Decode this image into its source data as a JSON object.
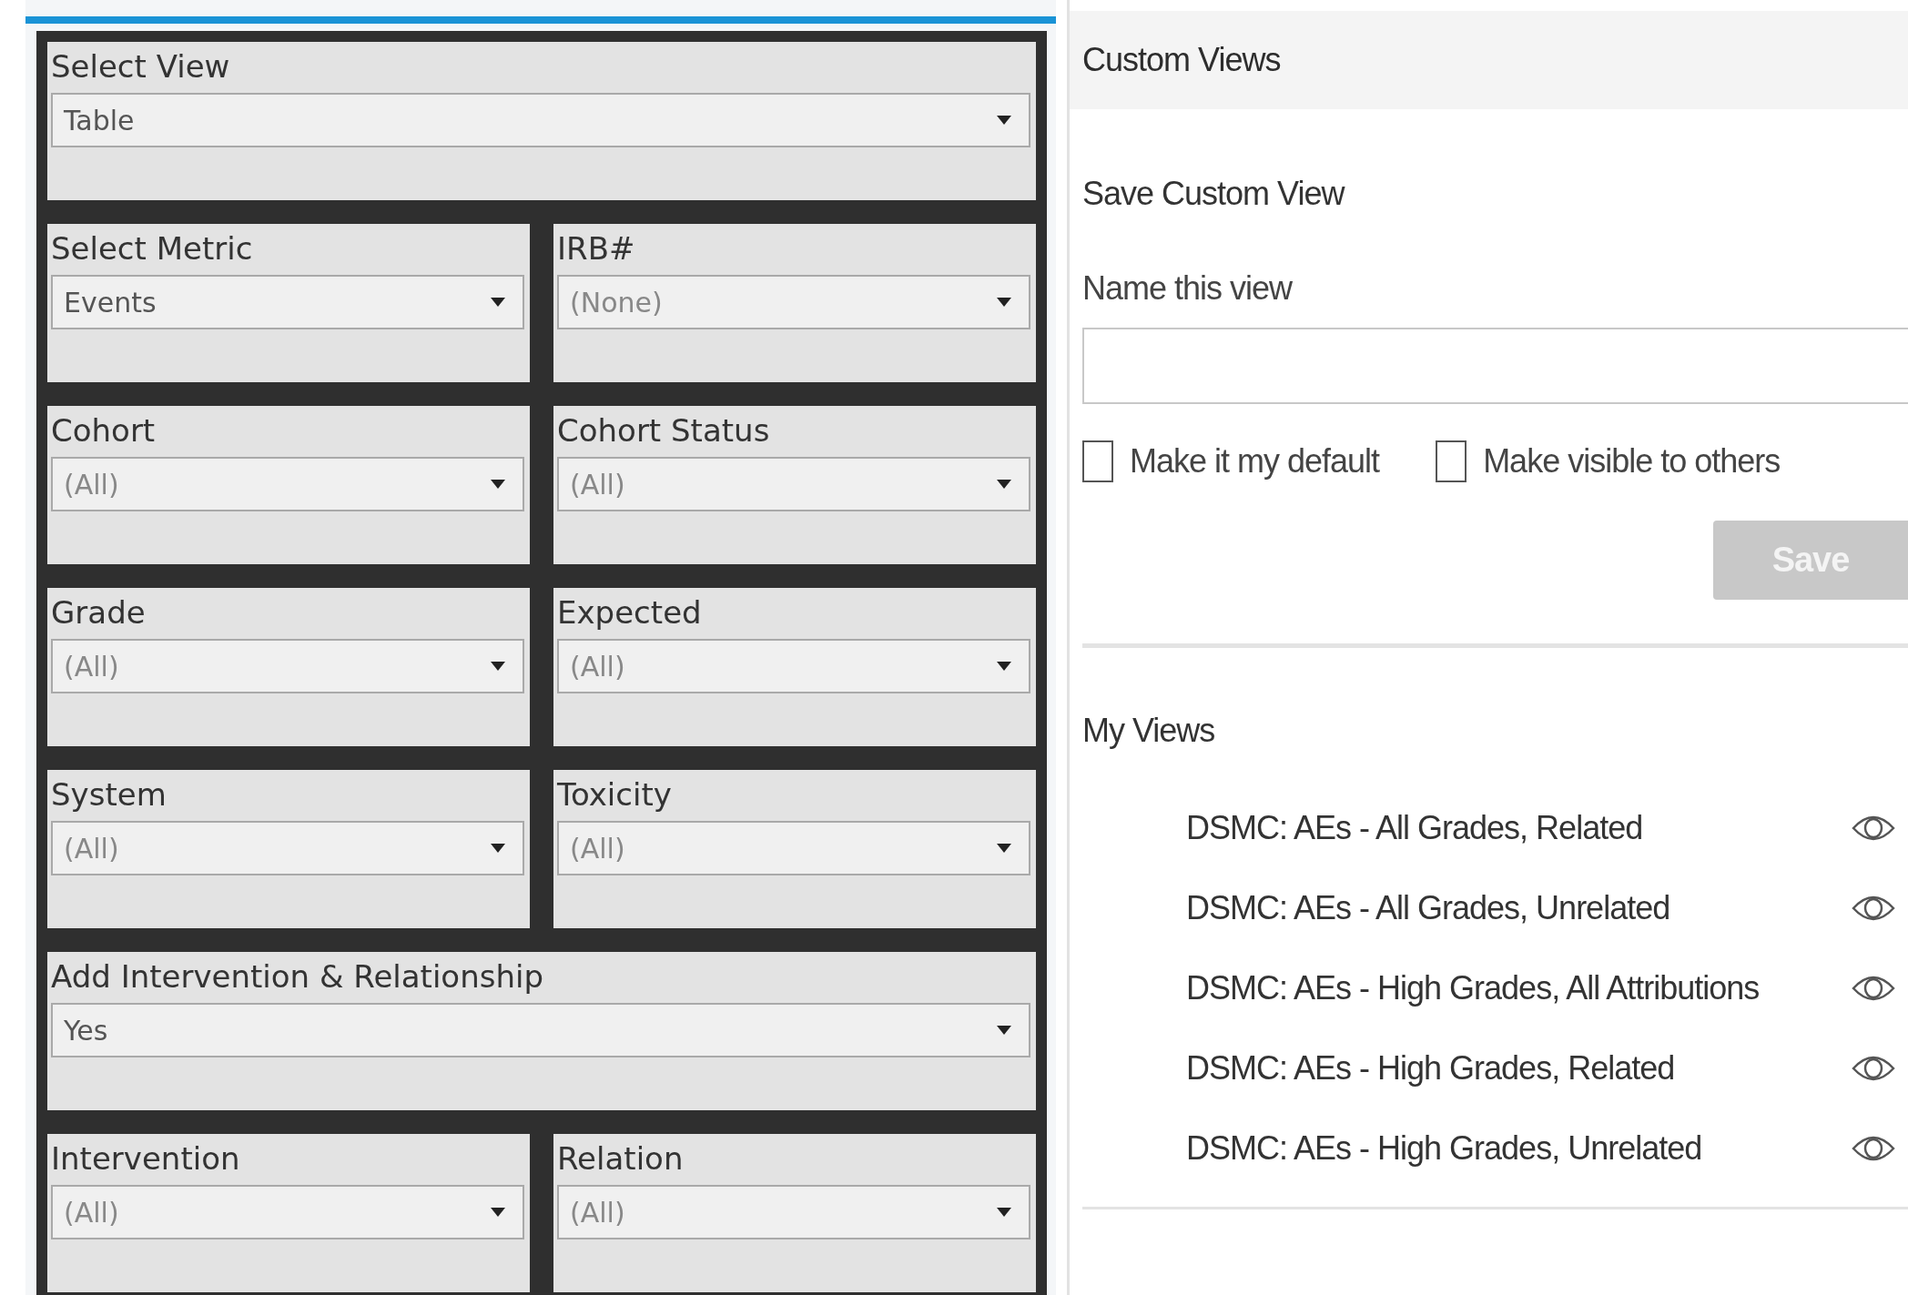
{
  "filters": [
    {
      "kind": "full",
      "label": "Select View",
      "value": "Table"
    },
    {
      "kind": "half",
      "label": "Select Metric",
      "value": "Events"
    },
    {
      "kind": "half",
      "label": "IRB#",
      "value": "(None)"
    },
    {
      "kind": "half",
      "label": "Cohort",
      "value": "(All)"
    },
    {
      "kind": "half",
      "label": "Cohort Status",
      "value": "(All)"
    },
    {
      "kind": "half",
      "label": "Grade",
      "value": "(All)"
    },
    {
      "kind": "half",
      "label": "Expected",
      "value": "(All)"
    },
    {
      "kind": "half",
      "label": "System",
      "value": "(All)"
    },
    {
      "kind": "half",
      "label": "Toxicity",
      "value": "(All)"
    },
    {
      "kind": "full",
      "label": "Add Intervention & Relationship",
      "value": "Yes"
    },
    {
      "kind": "half",
      "label": "Intervention",
      "value": "(All)"
    },
    {
      "kind": "half",
      "label": "Relation",
      "value": "(All)"
    }
  ],
  "custom_views": {
    "title": "Custom Views",
    "save_title": "Save Custom View",
    "name_label": "Name this view",
    "checkboxes": [
      {
        "label": "Make it my default",
        "checked": false
      },
      {
        "label": "Make visible to others",
        "checked": false
      }
    ],
    "save_button": {
      "label": "Save",
      "disabled": true
    },
    "my_views_title": "My Views",
    "views": [
      {
        "name": "DSMC: AEs - All Grades, Related"
      },
      {
        "name": "DSMC: AEs - All Grades, Unrelated"
      },
      {
        "name": "DSMC: AEs - High Grades, All Attributions"
      },
      {
        "name": "DSMC: AEs - High Grades, Related"
      },
      {
        "name": "DSMC: AEs - High Grades, Unrelated"
      }
    ]
  }
}
